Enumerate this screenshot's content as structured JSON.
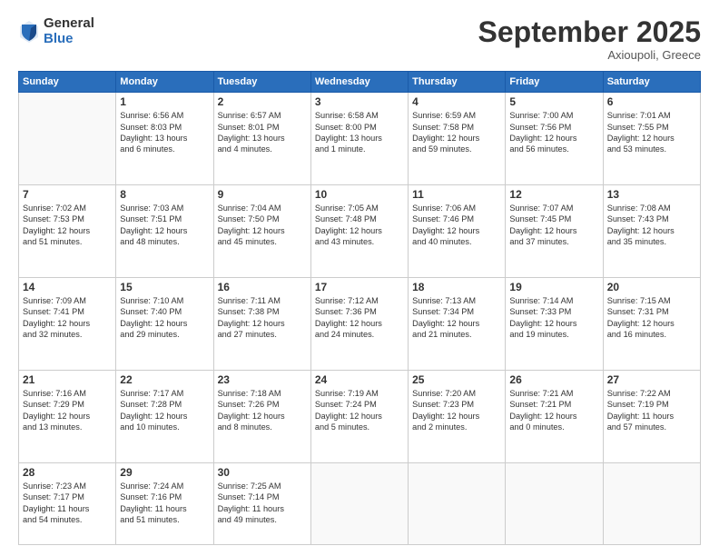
{
  "logo": {
    "general": "General",
    "blue": "Blue"
  },
  "header": {
    "title": "September 2025",
    "subtitle": "Axioupoli, Greece"
  },
  "days_of_week": [
    "Sunday",
    "Monday",
    "Tuesday",
    "Wednesday",
    "Thursday",
    "Friday",
    "Saturday"
  ],
  "weeks": [
    [
      {
        "day": "",
        "info": ""
      },
      {
        "day": "1",
        "info": "Sunrise: 6:56 AM\nSunset: 8:03 PM\nDaylight: 13 hours\nand 6 minutes."
      },
      {
        "day": "2",
        "info": "Sunrise: 6:57 AM\nSunset: 8:01 PM\nDaylight: 13 hours\nand 4 minutes."
      },
      {
        "day": "3",
        "info": "Sunrise: 6:58 AM\nSunset: 8:00 PM\nDaylight: 13 hours\nand 1 minute."
      },
      {
        "day": "4",
        "info": "Sunrise: 6:59 AM\nSunset: 7:58 PM\nDaylight: 12 hours\nand 59 minutes."
      },
      {
        "day": "5",
        "info": "Sunrise: 7:00 AM\nSunset: 7:56 PM\nDaylight: 12 hours\nand 56 minutes."
      },
      {
        "day": "6",
        "info": "Sunrise: 7:01 AM\nSunset: 7:55 PM\nDaylight: 12 hours\nand 53 minutes."
      }
    ],
    [
      {
        "day": "7",
        "info": "Sunrise: 7:02 AM\nSunset: 7:53 PM\nDaylight: 12 hours\nand 51 minutes."
      },
      {
        "day": "8",
        "info": "Sunrise: 7:03 AM\nSunset: 7:51 PM\nDaylight: 12 hours\nand 48 minutes."
      },
      {
        "day": "9",
        "info": "Sunrise: 7:04 AM\nSunset: 7:50 PM\nDaylight: 12 hours\nand 45 minutes."
      },
      {
        "day": "10",
        "info": "Sunrise: 7:05 AM\nSunset: 7:48 PM\nDaylight: 12 hours\nand 43 minutes."
      },
      {
        "day": "11",
        "info": "Sunrise: 7:06 AM\nSunset: 7:46 PM\nDaylight: 12 hours\nand 40 minutes."
      },
      {
        "day": "12",
        "info": "Sunrise: 7:07 AM\nSunset: 7:45 PM\nDaylight: 12 hours\nand 37 minutes."
      },
      {
        "day": "13",
        "info": "Sunrise: 7:08 AM\nSunset: 7:43 PM\nDaylight: 12 hours\nand 35 minutes."
      }
    ],
    [
      {
        "day": "14",
        "info": "Sunrise: 7:09 AM\nSunset: 7:41 PM\nDaylight: 12 hours\nand 32 minutes."
      },
      {
        "day": "15",
        "info": "Sunrise: 7:10 AM\nSunset: 7:40 PM\nDaylight: 12 hours\nand 29 minutes."
      },
      {
        "day": "16",
        "info": "Sunrise: 7:11 AM\nSunset: 7:38 PM\nDaylight: 12 hours\nand 27 minutes."
      },
      {
        "day": "17",
        "info": "Sunrise: 7:12 AM\nSunset: 7:36 PM\nDaylight: 12 hours\nand 24 minutes."
      },
      {
        "day": "18",
        "info": "Sunrise: 7:13 AM\nSunset: 7:34 PM\nDaylight: 12 hours\nand 21 minutes."
      },
      {
        "day": "19",
        "info": "Sunrise: 7:14 AM\nSunset: 7:33 PM\nDaylight: 12 hours\nand 19 minutes."
      },
      {
        "day": "20",
        "info": "Sunrise: 7:15 AM\nSunset: 7:31 PM\nDaylight: 12 hours\nand 16 minutes."
      }
    ],
    [
      {
        "day": "21",
        "info": "Sunrise: 7:16 AM\nSunset: 7:29 PM\nDaylight: 12 hours\nand 13 minutes."
      },
      {
        "day": "22",
        "info": "Sunrise: 7:17 AM\nSunset: 7:28 PM\nDaylight: 12 hours\nand 10 minutes."
      },
      {
        "day": "23",
        "info": "Sunrise: 7:18 AM\nSunset: 7:26 PM\nDaylight: 12 hours\nand 8 minutes."
      },
      {
        "day": "24",
        "info": "Sunrise: 7:19 AM\nSunset: 7:24 PM\nDaylight: 12 hours\nand 5 minutes."
      },
      {
        "day": "25",
        "info": "Sunrise: 7:20 AM\nSunset: 7:23 PM\nDaylight: 12 hours\nand 2 minutes."
      },
      {
        "day": "26",
        "info": "Sunrise: 7:21 AM\nSunset: 7:21 PM\nDaylight: 12 hours\nand 0 minutes."
      },
      {
        "day": "27",
        "info": "Sunrise: 7:22 AM\nSunset: 7:19 PM\nDaylight: 11 hours\nand 57 minutes."
      }
    ],
    [
      {
        "day": "28",
        "info": "Sunrise: 7:23 AM\nSunset: 7:17 PM\nDaylight: 11 hours\nand 54 minutes."
      },
      {
        "day": "29",
        "info": "Sunrise: 7:24 AM\nSunset: 7:16 PM\nDaylight: 11 hours\nand 51 minutes."
      },
      {
        "day": "30",
        "info": "Sunrise: 7:25 AM\nSunset: 7:14 PM\nDaylight: 11 hours\nand 49 minutes."
      },
      {
        "day": "",
        "info": ""
      },
      {
        "day": "",
        "info": ""
      },
      {
        "day": "",
        "info": ""
      },
      {
        "day": "",
        "info": ""
      }
    ]
  ]
}
